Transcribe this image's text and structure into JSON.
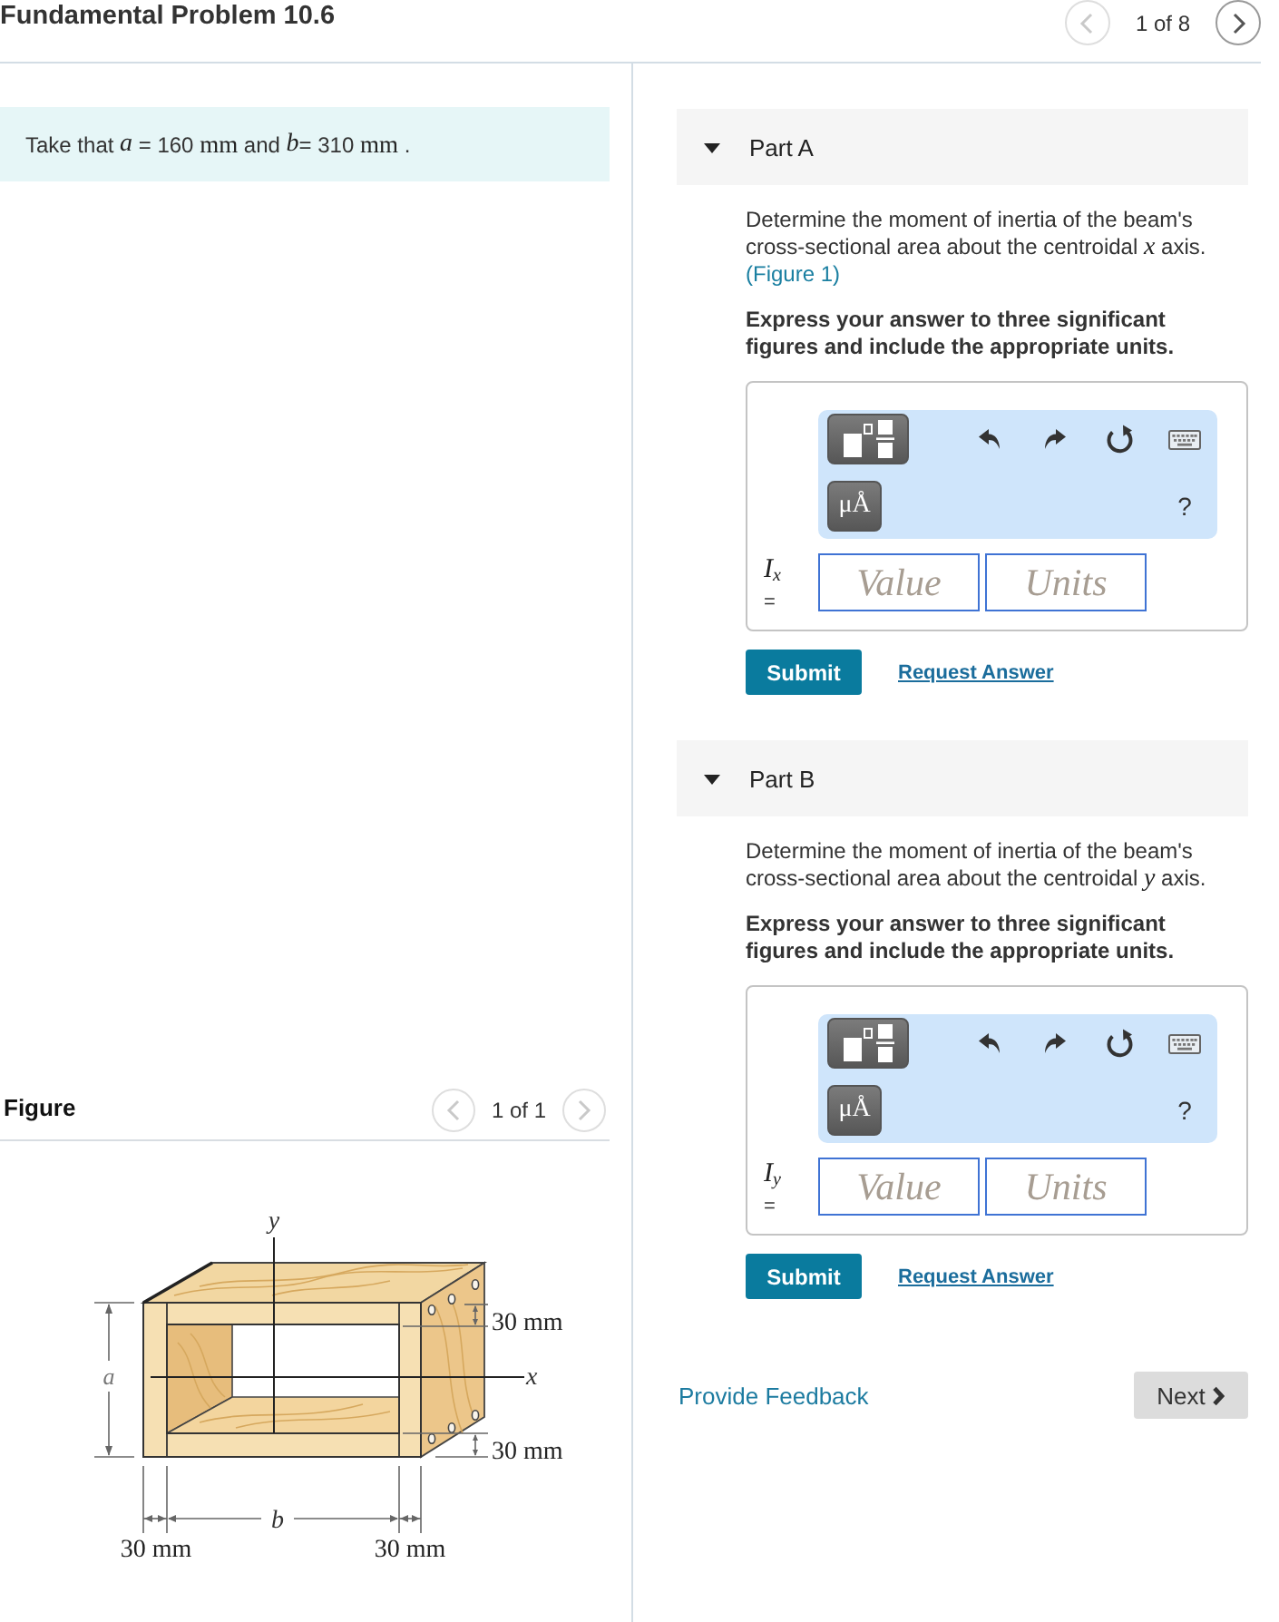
{
  "header": {
    "title": "Fundamental Problem 10.6",
    "pager": {
      "label": "1 of 8",
      "prev_disabled": true,
      "next_disabled": false
    }
  },
  "problem": {
    "statement": [
      {
        "kind": "text",
        "text": "Take that "
      },
      {
        "kind": "var",
        "text": "a"
      },
      {
        "kind": "text",
        "text": " = 160 "
      },
      {
        "kind": "unit",
        "text": "mm"
      },
      {
        "kind": "text",
        "text": " and "
      },
      {
        "kind": "var",
        "text": "b"
      },
      {
        "kind": "text",
        "text": "= 310 "
      },
      {
        "kind": "unit",
        "text": "mm"
      },
      {
        "kind": "text",
        "text": " ."
      }
    ]
  },
  "figure": {
    "title": "Figure",
    "pager": {
      "label": "1 of 1",
      "prev_disabled": true,
      "next_disabled": true
    },
    "diagram": {
      "y_axis": "y",
      "x_axis": "x",
      "height": "a",
      "width": "b",
      "top_thickness": "30 mm",
      "bottom_thickness": "30 mm",
      "left_thickness": "30 mm",
      "right_thickness": "30 mm"
    }
  },
  "parts": [
    {
      "title": "Part A",
      "expanded": true,
      "question": [
        {
          "kind": "text",
          "text": "Determine the moment of inertia of the beam's cross-sectional area about the centroidal "
        },
        {
          "kind": "var",
          "text": "x"
        },
        {
          "kind": "text",
          "text": " axis. "
        },
        {
          "kind": "link",
          "text": "(Figure 1)"
        }
      ],
      "instruction": "Express your answer to three significant figures and include the appropriate units.",
      "toolbar": {
        "units_label": "μÅ",
        "help_label": "?"
      },
      "answer": {
        "symbol": "I",
        "subscript": "x",
        "equals": "=",
        "value_placeholder": "Value",
        "units_placeholder": "Units"
      },
      "submit": "Submit",
      "request": "Request Answer"
    },
    {
      "title": "Part B",
      "expanded": true,
      "question": [
        {
          "kind": "text",
          "text": "Determine the moment of inertia of the beam's cross-sectional area about the centroidal "
        },
        {
          "kind": "var",
          "text": "y"
        },
        {
          "kind": "text",
          "text": " axis."
        }
      ],
      "instruction": "Express your answer to three significant figures and include the appropriate units.",
      "toolbar": {
        "units_label": "μÅ",
        "help_label": "?"
      },
      "answer": {
        "symbol": "I",
        "subscript": "y",
        "equals": "=",
        "value_placeholder": "Value",
        "units_placeholder": "Units"
      },
      "submit": "Submit",
      "request": "Request Answer"
    }
  ],
  "footer": {
    "feedback": "Provide Feedback",
    "next": "Next"
  }
}
